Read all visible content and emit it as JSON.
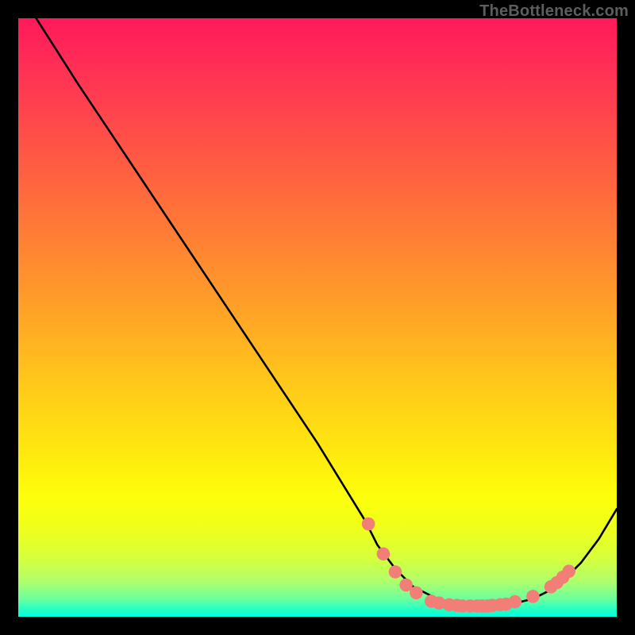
{
  "watermark": "TheBottleneck.com",
  "chart_data": {
    "type": "line",
    "title": "",
    "xlabel": "",
    "ylabel": "",
    "xlim": [
      0,
      100
    ],
    "ylim": [
      0,
      100
    ],
    "grid": false,
    "legend": false,
    "series": [
      {
        "name": "curve",
        "color": "#000000",
        "x": [
          3,
          10,
          20,
          30,
          40,
          50,
          58,
          60,
          63,
          66,
          70,
          74,
          78,
          82,
          86,
          90,
          94,
          97,
          100
        ],
        "y": [
          100,
          89,
          74,
          59,
          44,
          29,
          16,
          12,
          8,
          5,
          3,
          2,
          2,
          2,
          3,
          5,
          9,
          13,
          18
        ]
      }
    ],
    "markers": {
      "comment": "salmon dots near trough",
      "color": "#f27e78",
      "radius": 1.1,
      "points": [
        {
          "x": 58.5,
          "y": 15.5
        },
        {
          "x": 61.0,
          "y": 10.5
        },
        {
          "x": 63.0,
          "y": 7.5
        },
        {
          "x": 64.8,
          "y": 5.3
        },
        {
          "x": 66.5,
          "y": 4.0
        },
        {
          "x": 69.0,
          "y": 2.6
        },
        {
          "x": 70.3,
          "y": 2.3
        },
        {
          "x": 72.0,
          "y": 2.0
        },
        {
          "x": 73.3,
          "y": 1.9
        },
        {
          "x": 74.2,
          "y": 1.8
        },
        {
          "x": 75.5,
          "y": 1.8
        },
        {
          "x": 76.7,
          "y": 1.8
        },
        {
          "x": 77.5,
          "y": 1.8
        },
        {
          "x": 78.4,
          "y": 1.8
        },
        {
          "x": 79.2,
          "y": 1.9
        },
        {
          "x": 80.5,
          "y": 2.0
        },
        {
          "x": 81.5,
          "y": 2.1
        },
        {
          "x": 83.0,
          "y": 2.5
        },
        {
          "x": 86.0,
          "y": 3.4
        },
        {
          "x": 89.0,
          "y": 5.0
        },
        {
          "x": 90.0,
          "y": 5.7
        },
        {
          "x": 91.0,
          "y": 6.6
        },
        {
          "x": 92.0,
          "y": 7.6
        }
      ]
    },
    "gradient_stops_note": "Background encodes value from red (high) to cyan-green (low) vertically; no numeric colorbar shown."
  }
}
